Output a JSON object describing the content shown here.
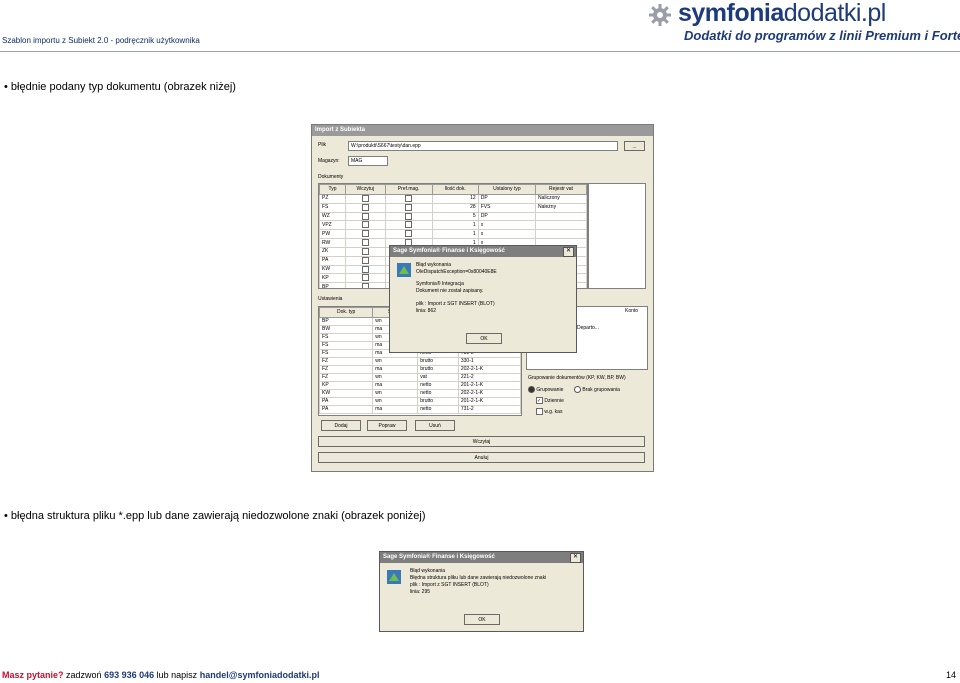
{
  "header": {
    "doc_title": "Szablon importu z Subiekt 2.0  - podręcznik użytkownika",
    "logo_main_a": "symfonia",
    "logo_main_b": "dodatki.pl",
    "logo_sub": "Dodatki do programów z linii Premium i Forte"
  },
  "bullets": [
    "błędnie podany typ dokumentu (obrazek niżej)",
    "błędna struktura pliku *.epp lub dane zawierają niedozwolone znaki (obrazek poniżej)"
  ],
  "import_window": {
    "title": "Import z Subiekta",
    "plik_label": "Plik",
    "plik_value": "W:\\produkti\\S667\\testy\\dan.epp",
    "browse_label": "...",
    "magazyn_label": "Magazyn:",
    "magazyn_value": "MAG",
    "dokumenty_label": "Dokumenty",
    "doc_columns": [
      "Typ",
      "Wczytuj",
      "Pref.mag.",
      "Ilość dok.",
      "Ustalony typ",
      "Rejestr vat"
    ],
    "doc_rows": [
      {
        "typ": "PZ",
        "count": "12",
        "ust": "DP",
        "rej": "Naliczony"
      },
      {
        "typ": "FS",
        "count": "28",
        "ust": "FVS",
        "rej": "Należny"
      },
      {
        "typ": "WZ",
        "count": "5",
        "ust": "DP",
        "rej": ""
      },
      {
        "typ": "VPZ",
        "count": "1",
        "ust": "x",
        "rej": ""
      },
      {
        "typ": "PW",
        "count": "1",
        "ust": "x",
        "rej": ""
      },
      {
        "typ": "RW",
        "count": "1",
        "ust": "x",
        "rej": ""
      },
      {
        "typ": "ZK",
        "count": "",
        "ust": "",
        "rej": ""
      },
      {
        "typ": "PA",
        "count": "",
        "ust": "",
        "rej": ""
      },
      {
        "typ": "KW",
        "count": "",
        "ust": "",
        "rej": ""
      },
      {
        "typ": "KP",
        "count": "",
        "ust": "",
        "rej": ""
      },
      {
        "typ": "BP",
        "count": "",
        "ust": "",
        "rej": ""
      }
    ],
    "ustawienia_label": "Ustawienia",
    "set_columns": [
      "Dok. typ",
      "Strona",
      "",
      ""
    ],
    "set_rows": [
      {
        "typ": "BP",
        "strona": "wn",
        "rodz": "",
        "konto": ""
      },
      {
        "typ": "BW",
        "strona": "ma",
        "rodz": "",
        "konto": ""
      },
      {
        "typ": "FS",
        "strona": "wn",
        "rodz": "",
        "konto": ""
      },
      {
        "typ": "FS",
        "strona": "ma",
        "rodz": "",
        "konto": ""
      },
      {
        "typ": "FS",
        "strona": "ma",
        "rodz": "netto",
        "konto": "731-2"
      },
      {
        "typ": "FZ",
        "strona": "wn",
        "rodz": "brutto",
        "konto": "330-1"
      },
      {
        "typ": "FZ",
        "strona": "ma",
        "rodz": "brutto",
        "konto": "202-2-1-K"
      },
      {
        "typ": "FZ",
        "strona": "wn",
        "rodz": "vat",
        "konto": "221-2"
      },
      {
        "typ": "KP",
        "strona": "ma",
        "rodz": "netto",
        "konto": "201-2-1-K"
      },
      {
        "typ": "KW",
        "strona": "wn",
        "rodz": "netto",
        "konto": "202-2-1-K"
      },
      {
        "typ": "PA",
        "strona": "wn",
        "rodz": "brutto",
        "konto": "201-2-1-K"
      },
      {
        "typ": "PA",
        "strona": "ma",
        "rodz": "netto",
        "konto": "731-2"
      }
    ],
    "konto_label": "Konto",
    "departo_label": "Departo...",
    "grupowanie_label": "Grupowanie dokumentów (KP, KW, BP, BW)",
    "radio_grupowanie": "Grupowanie",
    "radio_brak": "Brak grupowania",
    "check_dziennie": "Dziennie",
    "check_wg_kas": "w.g. kas",
    "btn_dodaj": "Dodaj",
    "btn_popraw": "Popraw",
    "btn_usun": "Usuń",
    "btn_wczytaj": "Wczytaj",
    "btn_anuluj": "Anuluj"
  },
  "error1": {
    "title": "Sage Symfonia® Finanse i Księgowość",
    "line1": "Błąd wykonania",
    "line2": "OleDispatchException=0x80040E8E",
    "line3": "Symfonia® Integracja",
    "line4": "Dokument nie został zapisany.",
    "line5": "plik : Import z SGT INSERT (BLOT)",
    "line6": "linia: 862",
    "ok": "OK"
  },
  "error2": {
    "title": "Sage Symfonia® Finanse i Księgowość",
    "line1": "Błąd wykonania",
    "line2": "Błędna struktura pliku lub dane zawierają niedozwolone znaki",
    "line3": "plik : Import z SGT INSERT (BLOT)",
    "line4": "linia: 295",
    "ok": "OK"
  },
  "footer": {
    "question": "Masz pytanie?",
    "call": "zadzwoń",
    "phone": "693 936 046",
    "or_write": "lub napisz",
    "email": "handel@symfoniadodatki.pl",
    "page": "14"
  },
  "colors": {
    "brand_blue": "#1d3a7a",
    "accent_red": "#c8102e"
  }
}
